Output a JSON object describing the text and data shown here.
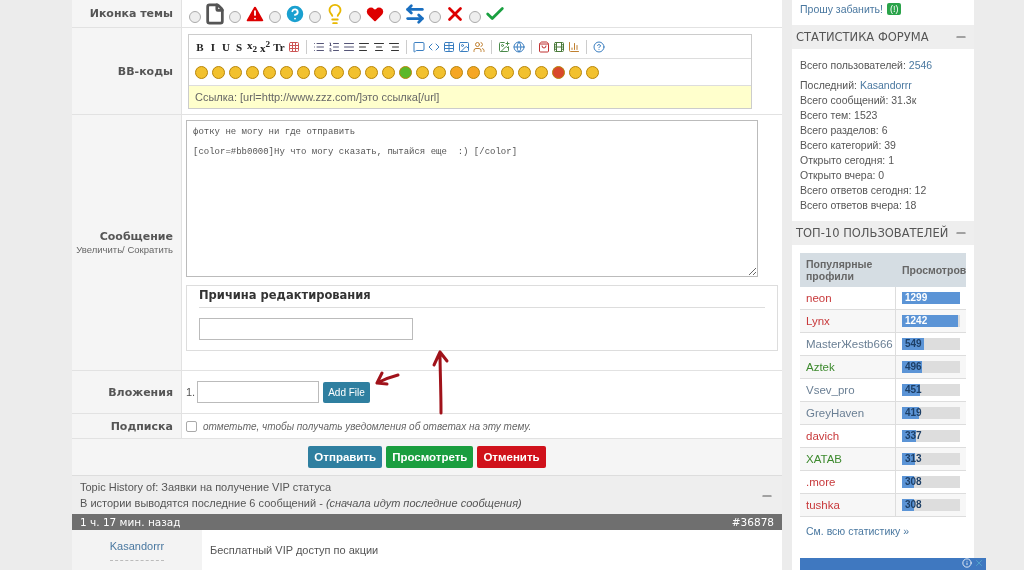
{
  "form": {
    "theme_icon": {
      "label": "Иконка темы",
      "options": [
        {
          "kind": "page",
          "selected": false
        },
        {
          "kind": "warning",
          "selected": false
        },
        {
          "kind": "question",
          "selected": false
        },
        {
          "kind": "bulb",
          "selected": false
        },
        {
          "kind": "heart",
          "selected": false
        },
        {
          "kind": "arrows",
          "selected": false
        },
        {
          "kind": "cross",
          "selected": false
        },
        {
          "kind": "check",
          "selected": false
        }
      ]
    },
    "bbcode": {
      "label": "BB-коды",
      "toolbar": [
        {
          "kind": "text",
          "label": "B"
        },
        {
          "kind": "text",
          "label": "I"
        },
        {
          "kind": "text",
          "label": "U"
        },
        {
          "kind": "text",
          "label": "S"
        },
        {
          "kind": "text",
          "label": "x$_{2}$"
        },
        {
          "kind": "text",
          "label": "x$^{2}$"
        },
        {
          "kind": "text",
          "label": "Tr"
        },
        {
          "kind": "colors"
        },
        {
          "kind": "separator"
        },
        {
          "kind": "bullets"
        },
        {
          "kind": "numbers"
        },
        {
          "kind": "lines"
        },
        {
          "kind": "align-left"
        },
        {
          "kind": "align-center"
        },
        {
          "kind": "align-right"
        },
        {
          "kind": "separator"
        },
        {
          "kind": "quote"
        },
        {
          "kind": "code"
        },
        {
          "kind": "table"
        },
        {
          "kind": "picture"
        },
        {
          "kind": "users"
        },
        {
          "kind": "separator"
        },
        {
          "kind": "image"
        },
        {
          "kind": "globe"
        },
        {
          "kind": "separator"
        },
        {
          "kind": "bag"
        },
        {
          "kind": "film"
        },
        {
          "kind": "chart"
        },
        {
          "kind": "separator"
        },
        {
          "kind": "help"
        }
      ],
      "smileys": [
        {
          "color": "#f2c12e"
        },
        {
          "color": "#f2c12e"
        },
        {
          "color": "#f2c12e"
        },
        {
          "color": "#f2c12e"
        },
        {
          "color": "#f2c12e"
        },
        {
          "color": "#f2c12e"
        },
        {
          "color": "#f2c12e"
        },
        {
          "color": "#f2c12e"
        },
        {
          "color": "#f2c12e"
        },
        {
          "color": "#f2c12e"
        },
        {
          "color": "#f2c12e"
        },
        {
          "color": "#f2c12e"
        },
        {
          "color": "#5cb82a"
        },
        {
          "color": "#f2c12e"
        },
        {
          "color": "#f2c12e"
        },
        {
          "color": "#f5a623"
        },
        {
          "color": "#f5a623"
        },
        {
          "color": "#f2c12e"
        },
        {
          "color": "#f2c12e"
        },
        {
          "color": "#f2c12e"
        },
        {
          "color": "#f2c12e"
        },
        {
          "color": "#d9482b"
        },
        {
          "color": "#f2c12e"
        },
        {
          "color": "#f2c12e"
        }
      ],
      "hint": "Ссылка: [url=http://www.zzz.com/]это ссылка[/url]"
    },
    "message": {
      "label": "Сообщение",
      "enlarge": "Увеличить",
      "sep": "/",
      "shrink": "Сократить",
      "value": "фотку не могу ни где отправить\n\n[color=#bb0000]Ну что могу сказать, пытайся еще  :) [/color]",
      "reason_title": "Причина редактирования"
    },
    "attachments": {
      "label": "Вложения",
      "index": "1.",
      "button": "Add File"
    },
    "subscribe": {
      "label": "Подписка",
      "checked": false,
      "text": "отметьте, чтобы получать уведомления об ответах на эту тему."
    },
    "buttons": [
      {
        "kind": "submit",
        "label": "Отправить"
      },
      {
        "kind": "preview",
        "label": "Просмотреть"
      },
      {
        "kind": "cancel",
        "label": "Отменить"
      }
    ]
  },
  "history": {
    "title": "Topic History of: Заявки на получение VIP статуса",
    "note": "В истории выводятся последние 6 сообщений - *(сначала идут последние сообщения)*",
    "post": {
      "time": "1 ч. 17 мин. назад",
      "number": "#36878",
      "author": "Kasandorrr",
      "text": "Бесплатный VIP доступ по акции"
    }
  },
  "sidebar": {
    "ban_link": "Прошу забанить!",
    "ban_badge": "(!)",
    "stats": {
      "title": "СТАТИСТИКА ФОРУМА",
      "items": [
        {
          "label": "Всего пользователей: ",
          "value": "2546",
          "linked": true
        },
        {
          "label": "Последний: ",
          "value": "Kasandorrr",
          "linked": true
        },
        {
          "label": "Всего сообщений: ",
          "value": "31.3к",
          "linked": false
        },
        {
          "label": "Всего тем: ",
          "value": "1523",
          "linked": false
        },
        {
          "label": "Всего разделов: ",
          "value": "6",
          "linked": false
        },
        {
          "label": "Всего категорий: ",
          "value": "39",
          "linked": false
        },
        {
          "label": "Открыто сегодня: ",
          "value": "1",
          "linked": false
        },
        {
          "label": "Открыто вчера: ",
          "value": "0",
          "linked": false
        },
        {
          "label": "Всего ответов сегодня: ",
          "value": "12",
          "linked": false
        },
        {
          "label": "Всего ответов вчера: ",
          "value": "18",
          "linked": false
        }
      ]
    },
    "top": {
      "title": "ТОП-10 ПОЛЬЗОВАТЕЛЕЙ",
      "columns": [
        "Популярные профили",
        "Просмотров"
      ],
      "rows": [
        {
          "name": "neon",
          "color": "#c8393b",
          "views": "1299",
          "level": 1
        },
        {
          "name": "Lynx",
          "color": "#c8393b",
          "views": "1242",
          "level": 0.96
        },
        {
          "name": "MasterЖestb666",
          "color": "#6a7f94",
          "views": "549",
          "level": 0.38
        },
        {
          "name": "Aztek",
          "color": "#3d8a2e",
          "views": "496",
          "level": 0.34
        },
        {
          "name": "Vsev_pro",
          "color": "#6a7f94",
          "views": "451",
          "level": 0.31
        },
        {
          "name": "GreyHaven",
          "color": "#6a7f94",
          "views": "419",
          "level": 0.29
        },
        {
          "name": "davich",
          "color": "#c8393b",
          "views": "337",
          "level": 0.24
        },
        {
          "name": "XATAB",
          "color": "#3d8a2e",
          "views": "313",
          "level": 0.22
        },
        {
          "name": ".more",
          "color": "#c8393b",
          "views": "308",
          "level": 0.21
        },
        {
          "name": "tushka",
          "color": "#c8393b",
          "views": "308",
          "level": 0.21
        }
      ],
      "more": "См. всю статистику »"
    }
  }
}
